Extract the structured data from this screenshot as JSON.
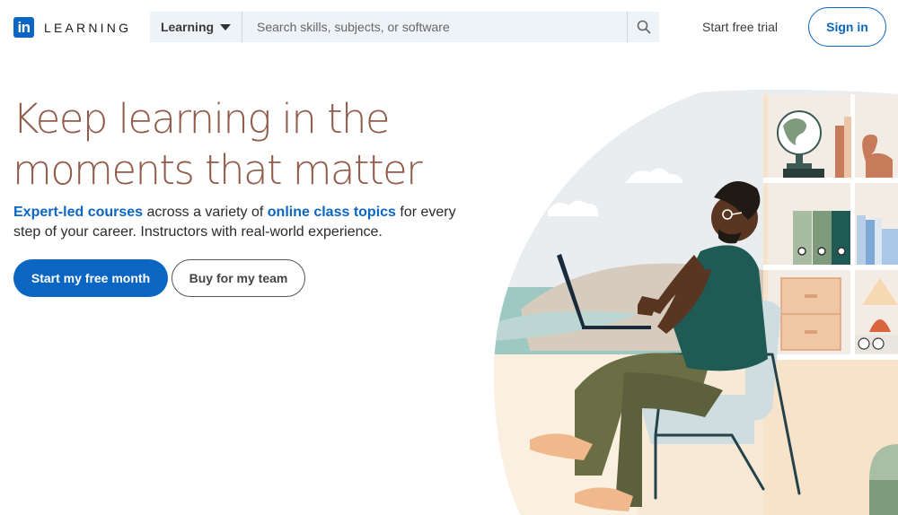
{
  "header": {
    "logo_mark": "in",
    "logo_text": "LEARNING",
    "search": {
      "category": "Learning",
      "placeholder": "Search skills, subjects, or software",
      "value": ""
    },
    "start_trial": "Start free trial",
    "sign_in": "Sign in"
  },
  "hero": {
    "title_line1": "Keep learning in the",
    "title_line2": "moments that matter",
    "desc": {
      "link1": "Expert-led courses",
      "text1": " across a variety of ",
      "link2": "online class topics",
      "text2": " for every step of your career. Instructors with real-world experience."
    },
    "primary_cta": "Start my free month",
    "secondary_cta": "Buy for my team"
  },
  "colors": {
    "brand": "#0a66c2",
    "headline": "#915b49"
  },
  "icons": {
    "search": "search-icon",
    "dropdown": "caret-down-icon"
  }
}
